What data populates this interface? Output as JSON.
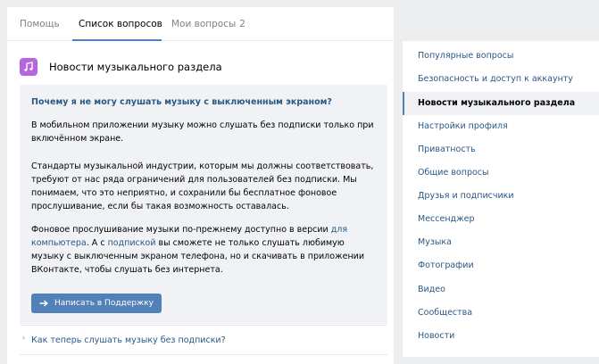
{
  "tabs": [
    {
      "label": "Помощь"
    },
    {
      "label": "Список вопросов"
    },
    {
      "label": "Мои вопросы",
      "count": "2"
    }
  ],
  "section": {
    "title": "Новости музыкального раздела",
    "icon": "music-note-icon",
    "icon_color": "#b764df"
  },
  "question": {
    "title": "Почему я не могу слушать музыку с выключенным экраном?",
    "p1": "В мобильном приложении музыку можно слушать без подписки только при включённом экране.",
    "p2": "Стандарты музыкальной индустрии, которым мы должны соответствовать, требуют от нас ряда ограничений для пользователей без подписки. Мы понимаем, что это неприятно, и сохранили бы бесплатное фоновое прослушивание, если бы такая возможность оставалась.",
    "p3_a": "Фоновое прослушивание музыки по-прежнему доступно в версии ",
    "p3_link1": "для компьютера",
    "p3_b": ". А с ",
    "p3_link2": "подпиской",
    "p3_c": " вы сможете не только слушать любимую музыку с выключенным экраном телефона, но и скачивать в приложении ВКонтакте, чтобы слушать без интернета.",
    "button_label": "Написать в Поддержку"
  },
  "next_question": {
    "label": "Как теперь слушать музыку без подписки?"
  },
  "sidebar": {
    "items": [
      {
        "label": "Популярные вопросы"
      },
      {
        "label": "Безопасность и доступ к аккаунту"
      },
      {
        "label": "Новости музыкального раздела"
      },
      {
        "label": "Настройки профиля"
      },
      {
        "label": "Приватность"
      },
      {
        "label": "Общие вопросы"
      },
      {
        "label": "Друзья и подписчики"
      },
      {
        "label": "Мессенджер"
      },
      {
        "label": "Музыка"
      },
      {
        "label": "Фотографии"
      },
      {
        "label": "Видео"
      },
      {
        "label": "Сообщества"
      },
      {
        "label": "Новости"
      }
    ]
  },
  "colors": {
    "accent": "#5181b8",
    "link": "#2a5885"
  }
}
